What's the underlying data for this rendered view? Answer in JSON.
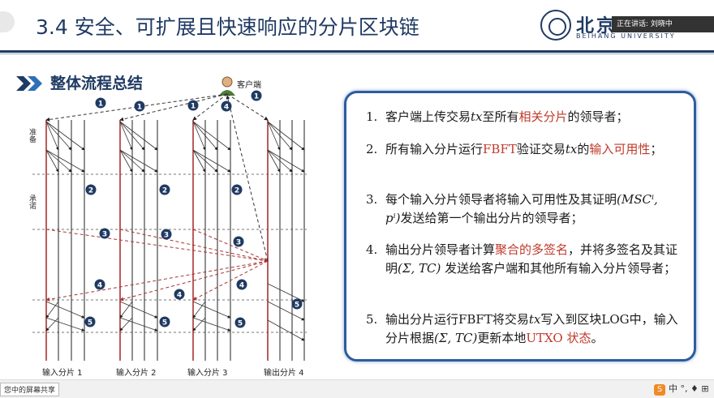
{
  "header": {
    "title": "3.4 安全、可扩展且快速响应的分片区块链",
    "logo_text": "北京",
    "logo_sub": "BEIHANG UNIVERSITY",
    "speaking": "正在讲话: 刘晓中"
  },
  "section": {
    "title": "整体流程总结"
  },
  "diagram": {
    "client_label": "客户端",
    "phase_labels": [
      "准备",
      "承诺"
    ],
    "lanes": [
      "输入分片 1",
      "输入分片 2",
      "输入分片 3",
      "输出分片 4"
    ],
    "step_markers": [
      "1",
      "2",
      "3",
      "4",
      "5"
    ]
  },
  "panel": {
    "steps": [
      {
        "num": "1.",
        "parts": [
          "客户端上传交易",
          "tx",
          "至所有",
          "相关分片",
          "的领导者；"
        ]
      },
      {
        "num": "2.",
        "parts": [
          "所有输入分片运行",
          "FBFT",
          "验证交易",
          "tx",
          "的",
          "输入可用性",
          "；"
        ]
      },
      {
        "num": "3.",
        "parts": [
          "每个输入分片领导者将输入可用性及其证明",
          "(MSCⁱ, pⁱ)",
          "发送给第一个输出分片的领导者；"
        ]
      },
      {
        "num": "4.",
        "parts": [
          " 输出分片领导者计算",
          "聚合的多签名",
          "，并将多签名及其证明",
          "(Σ, TC)",
          " 发送给客户端和其他所有输入分片领导者；"
        ]
      },
      {
        "num": "5.",
        "parts": [
          "输出分片运行FBFT将交易",
          "tx",
          "写入到区块LOG中，输入分片根据",
          "(Σ, TC)",
          "更新本地",
          "UTXO 状态",
          "。"
        ]
      }
    ]
  },
  "taskbar": {
    "share_label": "您中的屏幕共享",
    "tray": "中 °, ♦ ⊞"
  },
  "colors": {
    "title": "#1f3a63",
    "panel_border": "#2e5c9e",
    "highlight": "#c0392b",
    "marker": "#1f3a63"
  }
}
